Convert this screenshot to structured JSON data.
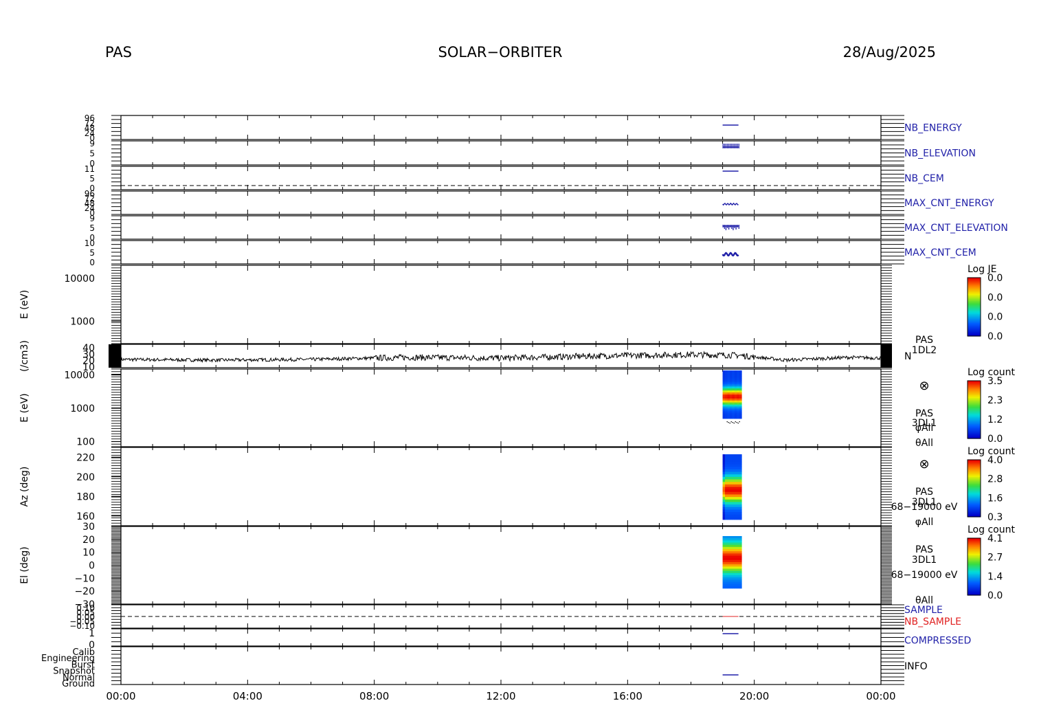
{
  "header": {
    "left": "PAS",
    "center": "SOLAR−ORBITER",
    "right": "28/Aug/2025"
  },
  "colors": {
    "blue": "#1f1fa8",
    "red": "#e02020",
    "black": "#000000"
  },
  "chart_data": {
    "type": "multi-panel time series and spectrograms",
    "x": {
      "range_hours": [
        0,
        24
      ],
      "tick_labels": [
        "00:00",
        "04:00",
        "08:00",
        "12:00",
        "16:00",
        "20:00",
        "00:00"
      ]
    },
    "data_window_hours": [
      19.0,
      19.6
    ],
    "panels": [
      {
        "id": "nb-energy",
        "right_label": "NB_ENERGY",
        "label_color": "blue",
        "y_tick_labels": [
          "96",
          "72",
          "48",
          "24",
          "0"
        ],
        "series": [
          {
            "t": [
              19.0,
              19.5
            ],
            "y": [
              85,
              85
            ]
          }
        ]
      },
      {
        "id": "nb-elevation",
        "right_label": "NB_ELEVATION",
        "label_color": "blue",
        "y_tick_labels": [
          "9",
          "5",
          "0"
        ],
        "series": [
          {
            "t": [
              19.0,
              19.5
            ],
            "y": [
              8,
              8
            ]
          }
        ]
      },
      {
        "id": "nb-cem",
        "right_label": "NB_CEM",
        "label_color": "blue",
        "y_tick_labels": [
          "11",
          "5",
          "0"
        ],
        "series": [
          {
            "t": [
              19.0,
              19.5
            ],
            "y": [
              10,
              10
            ]
          }
        ],
        "dashed_level": 0
      },
      {
        "id": "max-cnt-energy",
        "right_label": "MAX_CNT_ENERGY",
        "label_color": "blue",
        "y_tick_labels": [
          "96",
          "72",
          "48",
          "24",
          "0"
        ],
        "series": [
          {
            "t": [
              19.0,
              19.5
            ],
            "y": [
              35,
              35
            ]
          }
        ]
      },
      {
        "id": "max-cnt-elevation",
        "right_label": "MAX_CNT_ELEVATION",
        "label_color": "blue",
        "y_tick_labels": [
          "9",
          "5",
          "0"
        ],
        "series": [
          {
            "t": [
              19.0,
              19.5
            ],
            "y": [
              5,
              5
            ]
          }
        ]
      },
      {
        "id": "max-cnt-cem",
        "right_label": "MAX_CNT_CEM",
        "label_color": "blue",
        "y_tick_labels": [
          "10",
          "5",
          "0"
        ],
        "series": [
          {
            "t": [
              19.0,
              19.5
            ],
            "y": [
              3,
              3
            ]
          }
        ]
      },
      {
        "id": "energy-1dl2",
        "y_label": "E (eV)",
        "y_scale": "log",
        "y_range": [
          300,
          20000
        ],
        "y_tick_labels": [
          "10000",
          "1000"
        ],
        "colorbar": {
          "title": "Log JE",
          "labels": [
            "0.0",
            "0.0",
            "0.0",
            "0.0"
          ]
        }
      },
      {
        "id": "density",
        "y_label": "(/cm3)",
        "right_label": "N",
        "side_labels": [
          "PAS",
          "1DL2"
        ],
        "y_tick_labels": [
          "40",
          "30",
          "20",
          "10"
        ],
        "y_range": [
          8,
          42
        ],
        "trend": {
          "t": [
            0,
            3,
            6,
            9,
            12,
            15,
            18,
            19.5,
            21,
            23,
            24
          ],
          "y": [
            20,
            19,
            20,
            23,
            22,
            25,
            27,
            26,
            19,
            23,
            22
          ]
        }
      },
      {
        "id": "energy-3dl1",
        "y_label": "E (eV)",
        "y_scale": "log",
        "y_range": [
          70,
          15000
        ],
        "y_tick_labels": [
          "10000",
          "1000",
          "100"
        ],
        "side_labels": [
          "PAS",
          "3DL1",
          "φAll",
          "θAll"
        ],
        "colorbar": {
          "title": "Log count",
          "labels": [
            "3.5",
            "2.3",
            "1.2",
            "0.0"
          ],
          "min": 0.0,
          "max": 3.5
        }
      },
      {
        "id": "azimuth",
        "y_label": "Az (deg)",
        "y_range": [
          150,
          230
        ],
        "y_tick_labels": [
          "220",
          "200",
          "180",
          "160"
        ],
        "side_labels": [
          "PAS",
          "3DL1",
          "68−19000 eV",
          "φAll"
        ],
        "colorbar": {
          "title": "Log count",
          "labels": [
            "4.0",
            "2.8",
            "1.6",
            "0.3"
          ],
          "min": 0.3,
          "max": 4.0
        }
      },
      {
        "id": "elevation",
        "y_label": "El (deg)",
        "y_range": [
          -30,
          30
        ],
        "y_tick_labels": [
          "30",
          "20",
          "10",
          "0",
          "−10",
          "−20",
          "−30"
        ],
        "side_labels": [
          "PAS",
          "3DL1",
          "68−19000 eV",
          "θAll"
        ],
        "colorbar": {
          "title": "Log count",
          "labels": [
            "4.1",
            "2.7",
            "1.4",
            "0.0"
          ],
          "min": 0.0,
          "max": 4.1
        }
      },
      {
        "id": "sample",
        "right_labels": [
          "SAMPLE",
          "NB_SAMPLE"
        ],
        "right_label_colors": [
          "blue",
          "red"
        ],
        "y_tick_labels": [
          "0.10",
          "0.05",
          "0.00",
          "−0.05",
          "−0.10"
        ],
        "dashed_level": 0.0
      },
      {
        "id": "compressed",
        "right_label": "COMPRESSED",
        "label_color": "blue",
        "y_tick_labels": [
          "1",
          "0"
        ],
        "series": [
          {
            "t": [
              19.0,
              19.5
            ],
            "y": [
              1,
              1
            ]
          }
        ]
      },
      {
        "id": "info",
        "right_label": "INFO",
        "label_color": "black",
        "y_tick_labels": [
          "Calib",
          "Engineering",
          "Burst",
          "Snapshot",
          "Normal",
          "Ground"
        ],
        "series": [
          {
            "t": [
              19.0,
              19.5
            ],
            "y": [
              "Normal",
              "Normal"
            ]
          }
        ]
      }
    ]
  }
}
